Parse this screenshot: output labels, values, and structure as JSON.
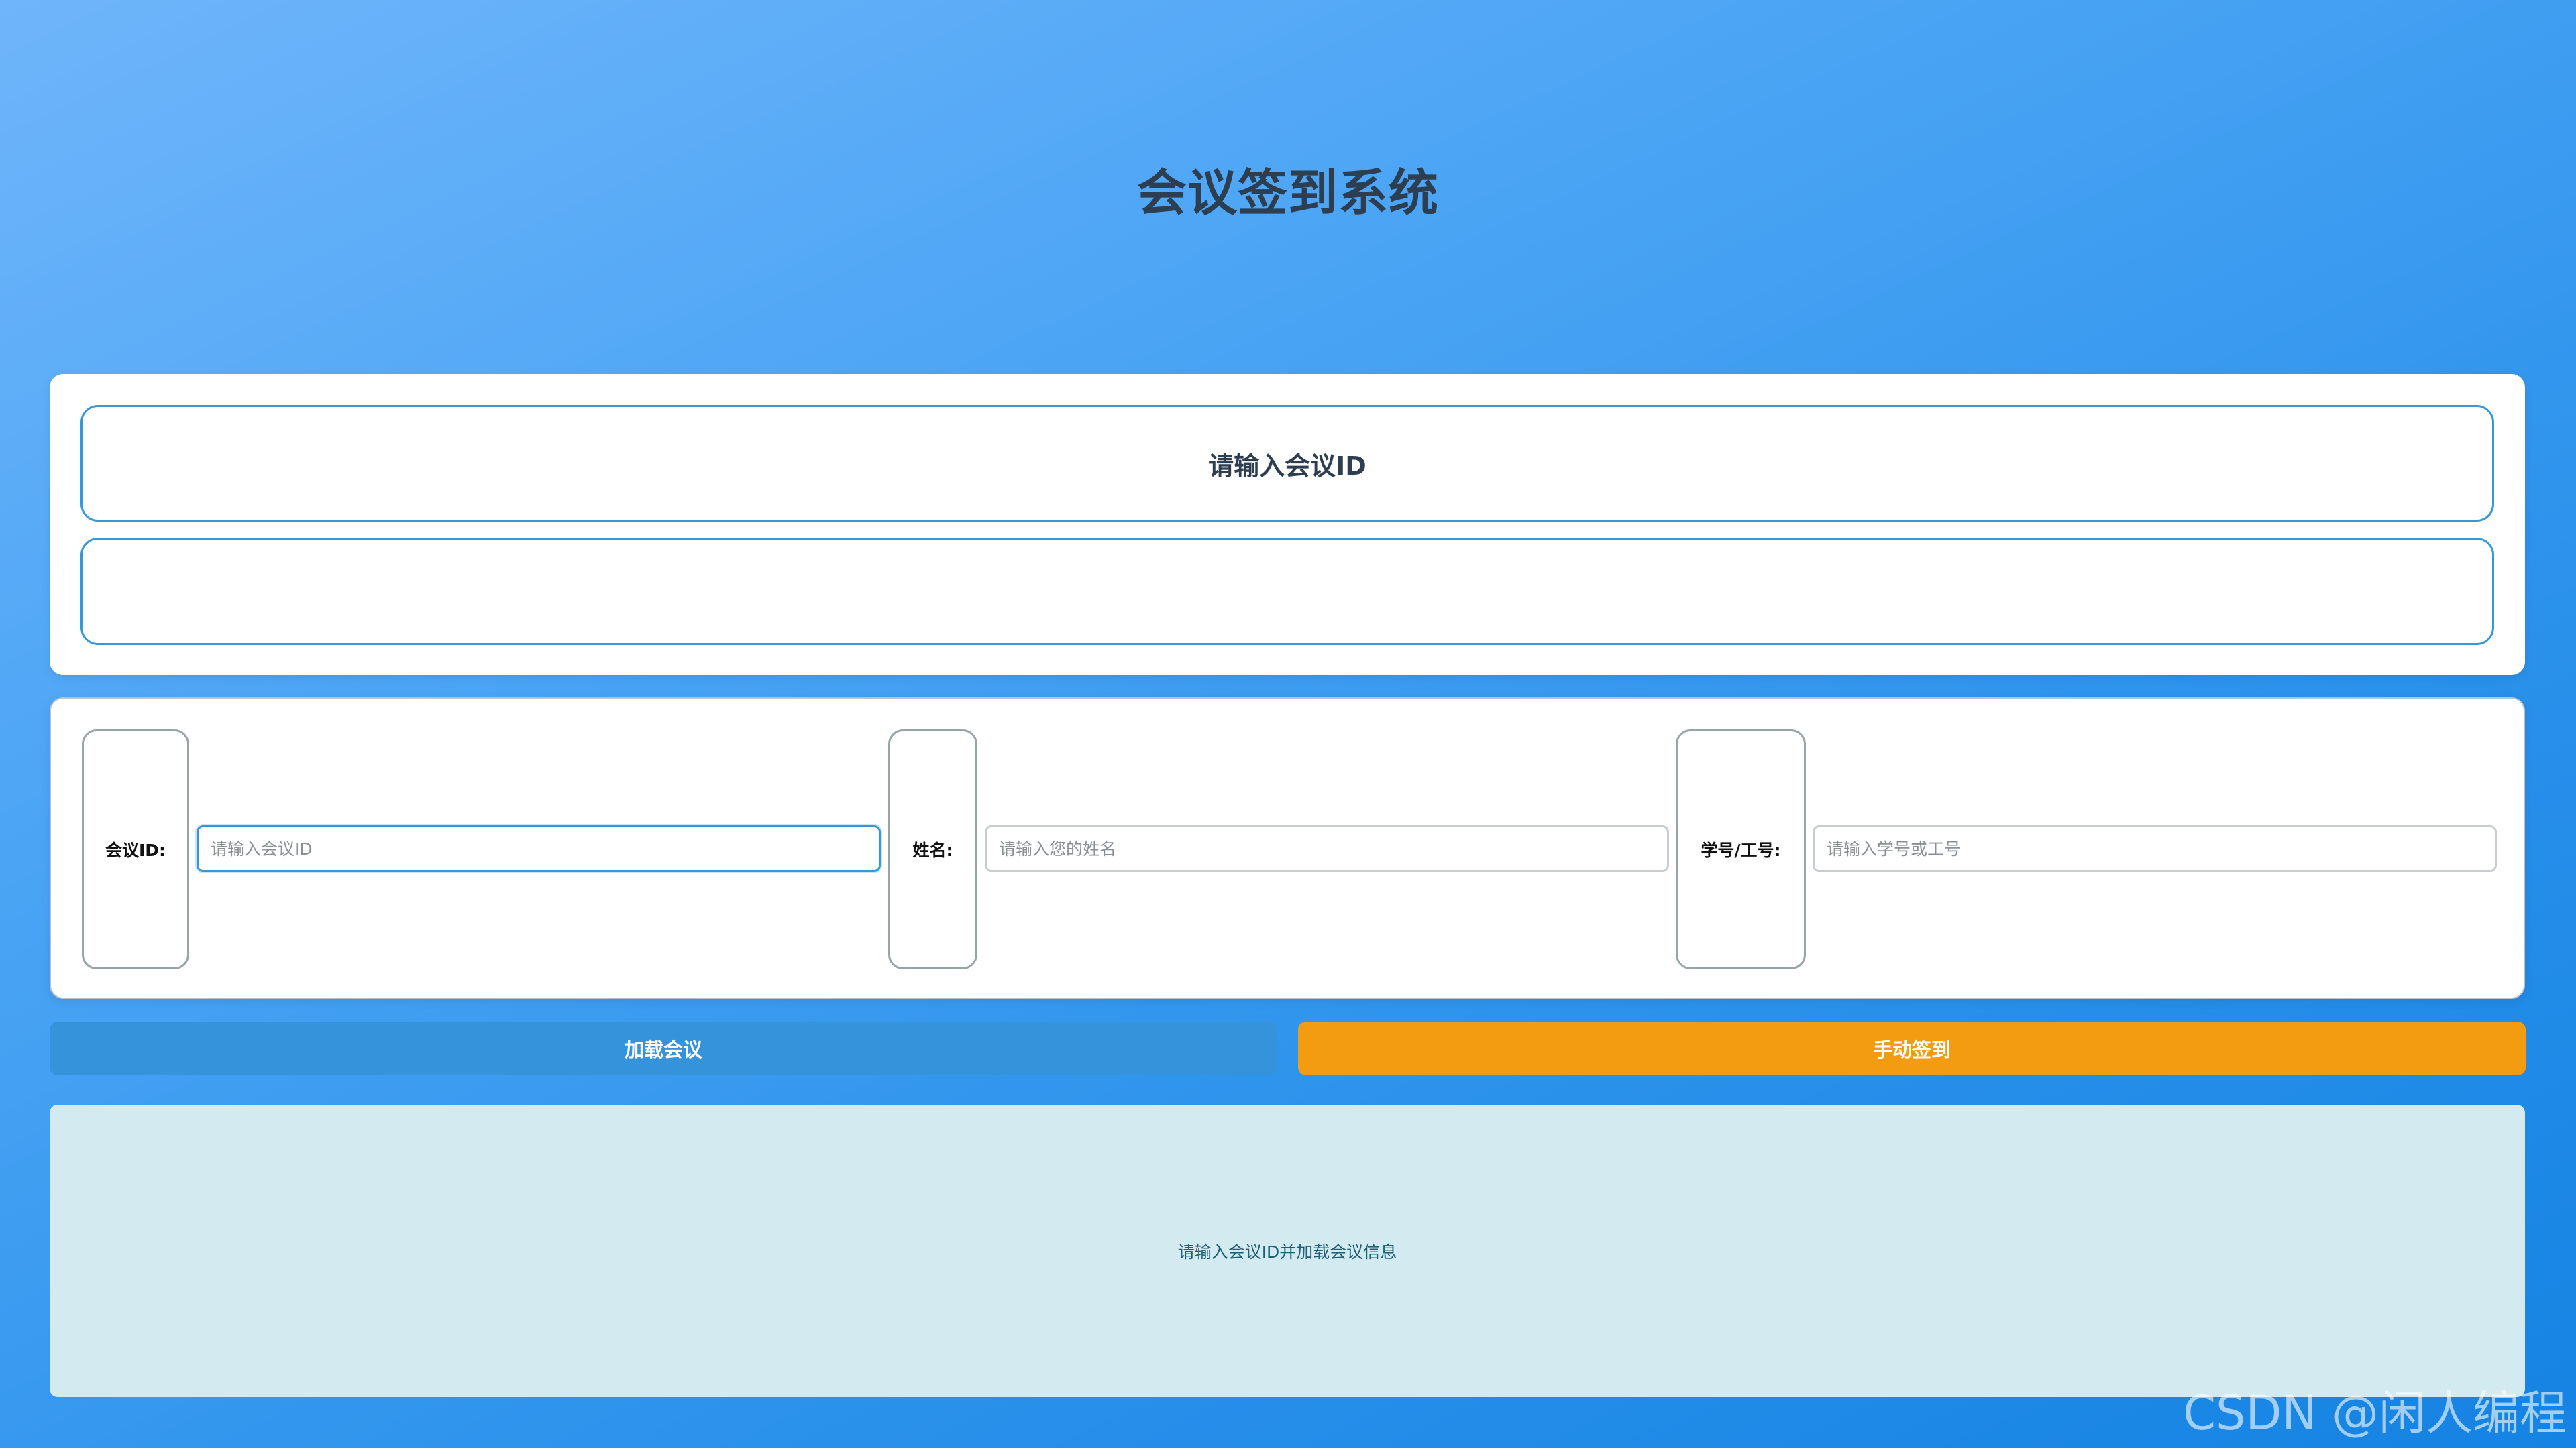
{
  "header": {
    "title": "会议签到系统"
  },
  "meeting": {
    "title": "请输入会议ID",
    "info": ""
  },
  "form": {
    "meeting_id_label": "会议ID:",
    "meeting_id_value": "",
    "meeting_id_placeholder": "请输入会议ID",
    "name_label": "姓名:",
    "name_value": "",
    "name_placeholder": "请输入您的姓名",
    "staff_id_label": "学号/工号:",
    "staff_id_value": "",
    "staff_id_placeholder": "请输入学号或工号"
  },
  "actions": {
    "load_label": "加载会议",
    "checkin_label": "手动签到"
  },
  "status": {
    "message": "请输入会议ID并加载会议信息"
  },
  "watermark": "CSDN @闲人编程",
  "colors": {
    "accent": "#3498db",
    "load_button": "#3593dc",
    "checkin_button": "#f39c12",
    "status_background": "#d2eaf0",
    "title_text": "#2c3e50"
  }
}
